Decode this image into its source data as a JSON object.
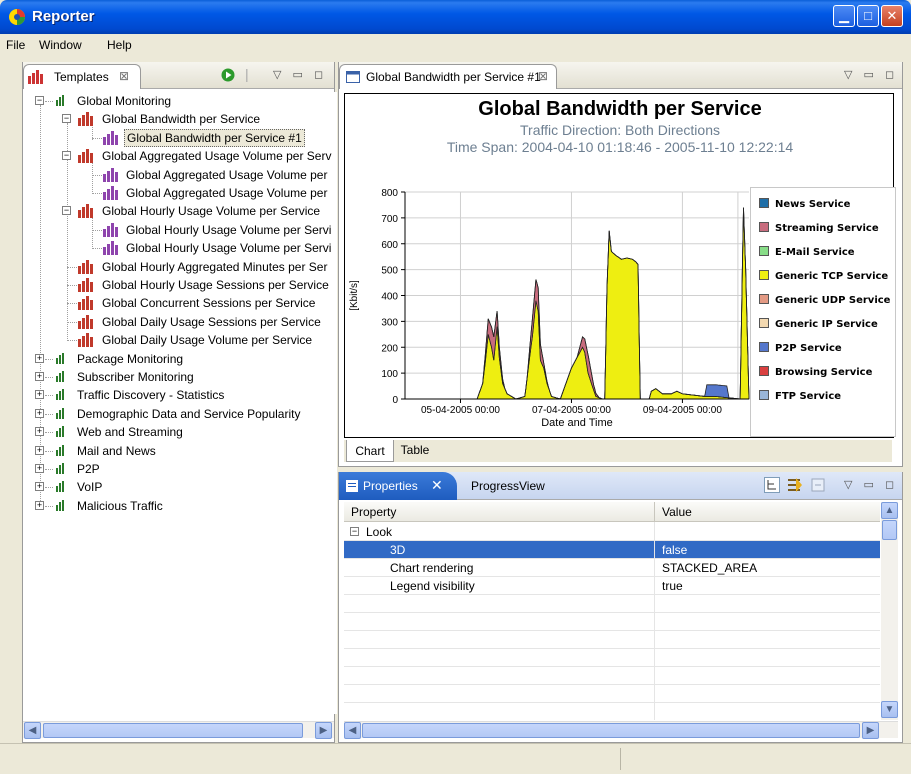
{
  "window": {
    "title": "Reporter",
    "colors": {
      "titlebar": "#0054e3",
      "selection": "#316ac5"
    }
  },
  "menu": [
    "File",
    "Window",
    "Help"
  ],
  "templates_view": {
    "tab_label": "Templates",
    "close_glyph": "⊠",
    "tree": [
      {
        "label": "Global Monitoring",
        "level": 0,
        "expanded": true,
        "icon": "group-chart-icon"
      },
      {
        "label": "Global Bandwidth per Service",
        "level": 1,
        "expanded": true,
        "icon": "report-icon"
      },
      {
        "label": "Global Bandwidth per Service #1",
        "level": 2,
        "icon": "report-instance-icon",
        "selected": true
      },
      {
        "label": "Global Aggregated Usage Volume per Serv",
        "level": 1,
        "expanded": true,
        "icon": "report-icon"
      },
      {
        "label": "Global Aggregated Usage Volume per",
        "level": 2,
        "icon": "report-instance-icon"
      },
      {
        "label": "Global Aggregated Usage Volume per",
        "level": 2,
        "icon": "report-instance-icon"
      },
      {
        "label": "Global Hourly Usage Volume per Service",
        "level": 1,
        "expanded": true,
        "icon": "report-icon"
      },
      {
        "label": "Global Hourly Usage Volume per Servi",
        "level": 2,
        "icon": "report-instance-icon"
      },
      {
        "label": "Global Hourly Usage Volume per Servi",
        "level": 2,
        "icon": "report-instance-icon"
      },
      {
        "label": "Global Hourly Aggregated Minutes per Ser",
        "level": 1,
        "icon": "report-icon"
      },
      {
        "label": "Global Hourly Usage Sessions per Service",
        "level": 1,
        "icon": "report-icon"
      },
      {
        "label": "Global Concurrent Sessions per Service",
        "level": 1,
        "icon": "report-icon"
      },
      {
        "label": "Global Daily Usage Sessions per Service",
        "level": 1,
        "icon": "report-icon"
      },
      {
        "label": "Global Daily Usage Volume per Service",
        "level": 1,
        "icon": "report-icon"
      },
      {
        "label": "Package Monitoring",
        "level": 0,
        "expanded": false,
        "icon": "group-chart-icon"
      },
      {
        "label": "Subscriber Monitoring",
        "level": 0,
        "expanded": false,
        "icon": "group-chart-icon"
      },
      {
        "label": "Traffic Discovery - Statistics",
        "level": 0,
        "expanded": false,
        "icon": "group-chart-icon"
      },
      {
        "label": "Demographic Data and Service Popularity",
        "level": 0,
        "expanded": false,
        "icon": "group-chart-icon"
      },
      {
        "label": "Web and Streaming",
        "level": 0,
        "expanded": false,
        "icon": "group-chart-icon"
      },
      {
        "label": "Mail and News",
        "level": 0,
        "expanded": false,
        "icon": "group-chart-icon"
      },
      {
        "label": "P2P",
        "level": 0,
        "expanded": false,
        "icon": "group-chart-icon"
      },
      {
        "label": "VoIP",
        "level": 0,
        "expanded": false,
        "icon": "group-chart-icon"
      },
      {
        "label": "Malicious Traffic",
        "level": 0,
        "expanded": false,
        "icon": "group-chart-icon"
      }
    ]
  },
  "editor": {
    "tab_label": "Global Bandwidth per Service #1",
    "close_glyph": "⊠",
    "bottom_tabs": [
      "Chart",
      "Table"
    ],
    "active_bottom_tab": "Chart"
  },
  "chart_data": {
    "type": "area",
    "stacked": true,
    "title": "Global Bandwidth per Service",
    "subtitle_1": "Traffic Direction: Both Directions",
    "subtitle_2": "Time Span: 2004-04-10 01:18:46 - 2005-11-10 12:22:14",
    "xlabel": "Date and Time",
    "ylabel": "[Kbit/s]",
    "ylim": [
      0,
      800
    ],
    "yticks": [
      0,
      100,
      200,
      300,
      400,
      500,
      600,
      700,
      800
    ],
    "xticks": [
      "05-04-2005 00:00",
      "07-04-2005 00:00",
      "09-04-2005 00:00"
    ],
    "grid": true,
    "legend_position": "right",
    "x_range_days": [
      3.5,
      6.6
    ],
    "series": [
      {
        "name": "News Service",
        "color": "#1f6fa8",
        "points": []
      },
      {
        "name": "Streaming Service",
        "color": "#c86c7e",
        "points": [
          [
            4.2,
            0
          ],
          [
            4.25,
            60
          ],
          [
            4.3,
            90
          ],
          [
            4.35,
            40
          ],
          [
            4.4,
            0
          ],
          [
            4.6,
            0
          ],
          [
            4.65,
            70
          ],
          [
            4.7,
            90
          ],
          [
            4.75,
            20
          ],
          [
            4.8,
            0
          ],
          [
            5.05,
            0
          ],
          [
            5.1,
            40
          ],
          [
            5.15,
            70
          ],
          [
            5.2,
            20
          ],
          [
            5.25,
            0
          ],
          [
            6.6,
            0
          ]
        ]
      },
      {
        "name": "E-Mail Service",
        "color": "#88dd88",
        "points": []
      },
      {
        "name": "Generic TCP Service",
        "color": "#eeee11",
        "points": [
          [
            3.5,
            0
          ],
          [
            4.15,
            0
          ],
          [
            4.2,
            60
          ],
          [
            4.22,
            130
          ],
          [
            4.25,
            250
          ],
          [
            4.28,
            200
          ],
          [
            4.3,
            150
          ],
          [
            4.33,
            280
          ],
          [
            4.35,
            160
          ],
          [
            4.38,
            60
          ],
          [
            4.42,
            20
          ],
          [
            4.5,
            0
          ],
          [
            4.58,
            10
          ],
          [
            4.62,
            150
          ],
          [
            4.65,
            250
          ],
          [
            4.68,
            380
          ],
          [
            4.7,
            340
          ],
          [
            4.72,
            150
          ],
          [
            4.75,
            120
          ],
          [
            4.78,
            60
          ],
          [
            4.82,
            10
          ],
          [
            4.9,
            0
          ],
          [
            4.95,
            60
          ],
          [
            5.0,
            120
          ],
          [
            5.05,
            160
          ],
          [
            5.1,
            200
          ],
          [
            5.12,
            180
          ],
          [
            5.15,
            100
          ],
          [
            5.18,
            60
          ],
          [
            5.22,
            10
          ],
          [
            5.28,
            0
          ],
          [
            5.3,
            0
          ],
          [
            5.32,
            430
          ],
          [
            5.34,
            650
          ],
          [
            5.36,
            570
          ],
          [
            5.4,
            555
          ],
          [
            5.45,
            540
          ],
          [
            5.5,
            545
          ],
          [
            5.55,
            540
          ],
          [
            5.58,
            530
          ],
          [
            5.6,
            520
          ],
          [
            5.62,
            0
          ],
          [
            5.7,
            0
          ],
          [
            5.72,
            30
          ],
          [
            5.76,
            40
          ],
          [
            5.82,
            20
          ],
          [
            5.9,
            20
          ],
          [
            5.95,
            30
          ],
          [
            6.0,
            20
          ],
          [
            6.1,
            15
          ],
          [
            6.2,
            10
          ],
          [
            6.3,
            10
          ],
          [
            6.52,
            0
          ],
          [
            6.55,
            740
          ],
          [
            6.57,
            500
          ],
          [
            6.6,
            0
          ]
        ]
      },
      {
        "name": "Generic UDP Service",
        "color": "#e39a84",
        "points": []
      },
      {
        "name": "Generic IP Service",
        "color": "#f3d9b1",
        "points": []
      },
      {
        "name": "P2P Service",
        "color": "#5577cc",
        "points": [
          [
            6.2,
            0
          ],
          [
            6.22,
            45
          ],
          [
            6.4,
            45
          ],
          [
            6.42,
            0
          ]
        ]
      },
      {
        "name": "Browsing Service",
        "color": "#d94040",
        "points": []
      },
      {
        "name": "FTP Service",
        "color": "#9ab6d8",
        "points": []
      }
    ]
  },
  "bottom_panel": {
    "tabs": [
      "Properties",
      "ProgressView"
    ],
    "active_tab": "Properties",
    "columns": [
      "Property",
      "Value"
    ],
    "group_label": "Look",
    "rows": [
      {
        "property": "3D",
        "value": "false",
        "selected": true
      },
      {
        "property": "Chart rendering",
        "value": "STACKED_AREA",
        "selected": false
      },
      {
        "property": "Legend visibility",
        "value": "true",
        "selected": false
      }
    ]
  }
}
